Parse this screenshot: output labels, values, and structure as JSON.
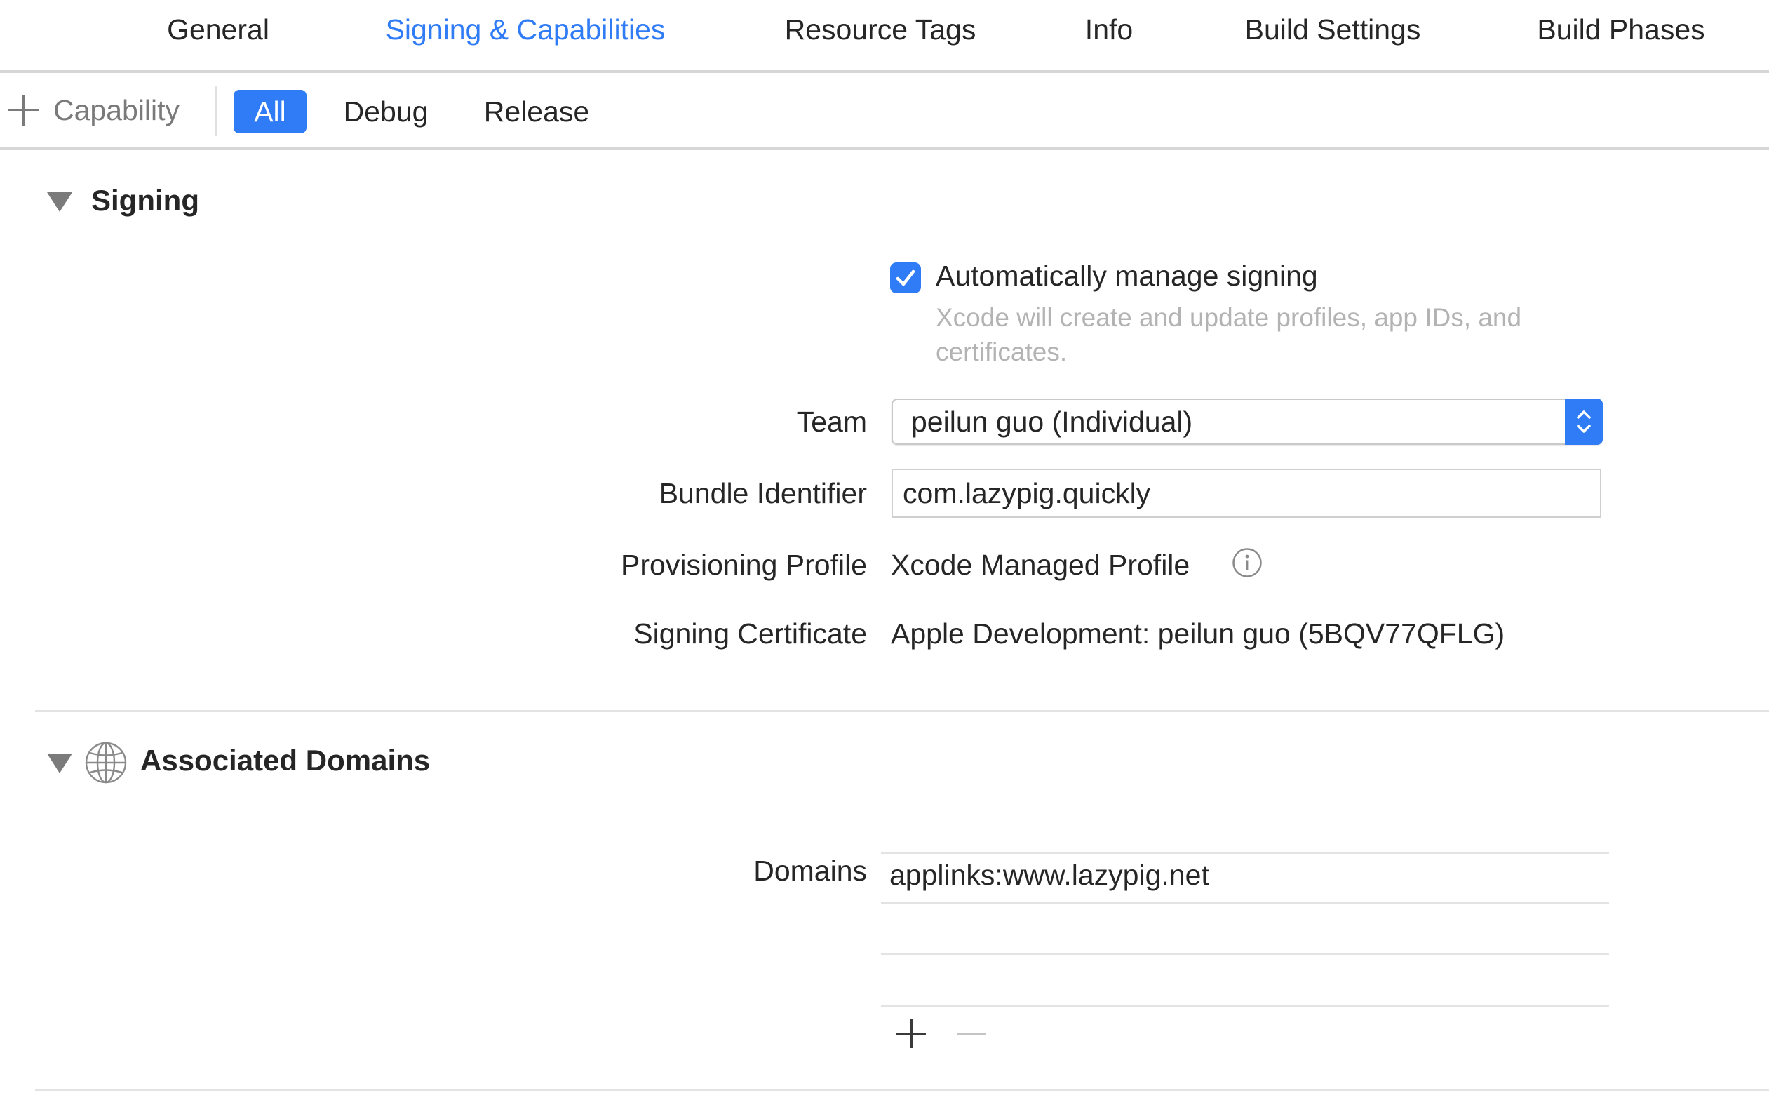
{
  "tabs": [
    {
      "label": "General"
    },
    {
      "label": "Signing & Capabilities",
      "active": true
    },
    {
      "label": "Resource Tags"
    },
    {
      "label": "Info"
    },
    {
      "label": "Build Settings"
    },
    {
      "label": "Build Phases"
    }
  ],
  "toolbar": {
    "capability_label": "Capability",
    "configurations": [
      {
        "label": "All",
        "selected": true
      },
      {
        "label": "Debug"
      },
      {
        "label": "Release"
      }
    ]
  },
  "signing": {
    "title": "Signing",
    "auto_manage": {
      "label": "Automatically manage signing",
      "checked": true,
      "help": "Xcode will create and update profiles, app IDs, and certificates."
    },
    "team": {
      "label": "Team",
      "value": "peilun guo (Individual)"
    },
    "bundle_identifier": {
      "label": "Bundle Identifier",
      "value": "com.lazypig.quickly"
    },
    "provisioning_profile": {
      "label": "Provisioning Profile",
      "value": "Xcode Managed Profile"
    },
    "signing_certificate": {
      "label": "Signing Certificate",
      "value": "Apple Development: peilun guo (5BQV77QFLG)"
    }
  },
  "associated_domains": {
    "title": "Associated Domains",
    "domains_label": "Domains",
    "domains": [
      "applinks:www.lazypig.net"
    ]
  },
  "colors": {
    "accent": "#2f7cf6",
    "text": "#262626",
    "secondary_text": "#b3b3b3",
    "separator": "#d6d6d6"
  }
}
